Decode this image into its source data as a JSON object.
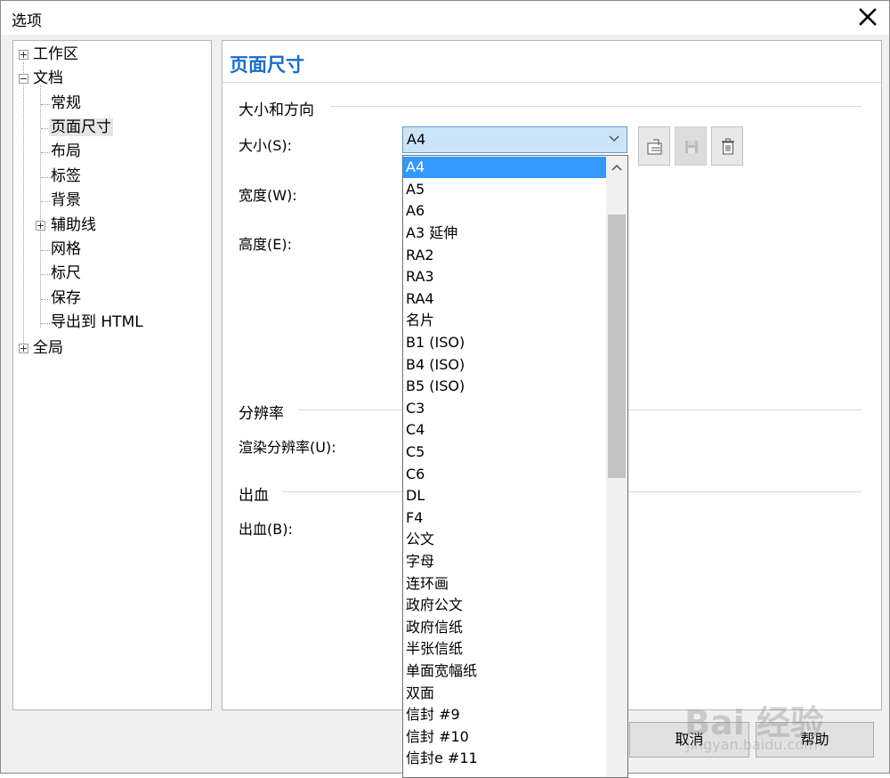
{
  "window": {
    "title": "选项"
  },
  "tree": {
    "items": [
      {
        "label": "工作区"
      },
      {
        "label": "文档"
      },
      {
        "label": "常规"
      },
      {
        "label": "页面尺寸"
      },
      {
        "label": "布局"
      },
      {
        "label": "标签"
      },
      {
        "label": "背景"
      },
      {
        "label": "辅助线"
      },
      {
        "label": "网格"
      },
      {
        "label": "标尺"
      },
      {
        "label": "保存"
      },
      {
        "label": "导出到 HTML"
      },
      {
        "label": "全局"
      }
    ]
  },
  "panel": {
    "title": "页面尺寸",
    "sections": {
      "size_orientation": "大小和方向",
      "resolution": "分辨率",
      "bleed": "出血"
    },
    "labels": {
      "size": "大小(S):",
      "width": "宽度(W):",
      "height": "高度(E):",
      "render_resolution": "渲染分辨率(U):",
      "bleed": "出血(B):"
    },
    "size_select": {
      "value": "A4"
    }
  },
  "dropdown": {
    "options": [
      "A4",
      "A5",
      "A6",
      "A3 延伸",
      "RA2",
      "RA3",
      "RA4",
      "名片",
      "B1 (ISO)",
      "B4 (ISO)",
      "B5 (ISO)",
      "C3",
      "C4",
      "C5",
      "C6",
      "DL",
      "F4",
      "公文",
      "字母",
      "连环画",
      "政府公文",
      "政府信纸",
      "半张信纸",
      "单面宽幅纸",
      "双面",
      "信封 #9",
      "信封 #10",
      "信封e #11"
    ],
    "selected": "A4"
  },
  "footer": {
    "cancel": "取消",
    "help": "帮助"
  },
  "watermark": {
    "brand": "Bai 经验",
    "url": "jingyan.baidu.com"
  },
  "icons": {
    "close": "close-icon",
    "add_preset": "add-page-preset-icon",
    "save_preset": "save-icon",
    "delete_preset": "trash-icon",
    "dropdown": "chevron-down-icon",
    "scroll_up": "chevron-up-icon"
  },
  "colors": {
    "accent": "#1a6fc4",
    "selection": "#3399ff",
    "select_bg": "#cce4f7"
  }
}
